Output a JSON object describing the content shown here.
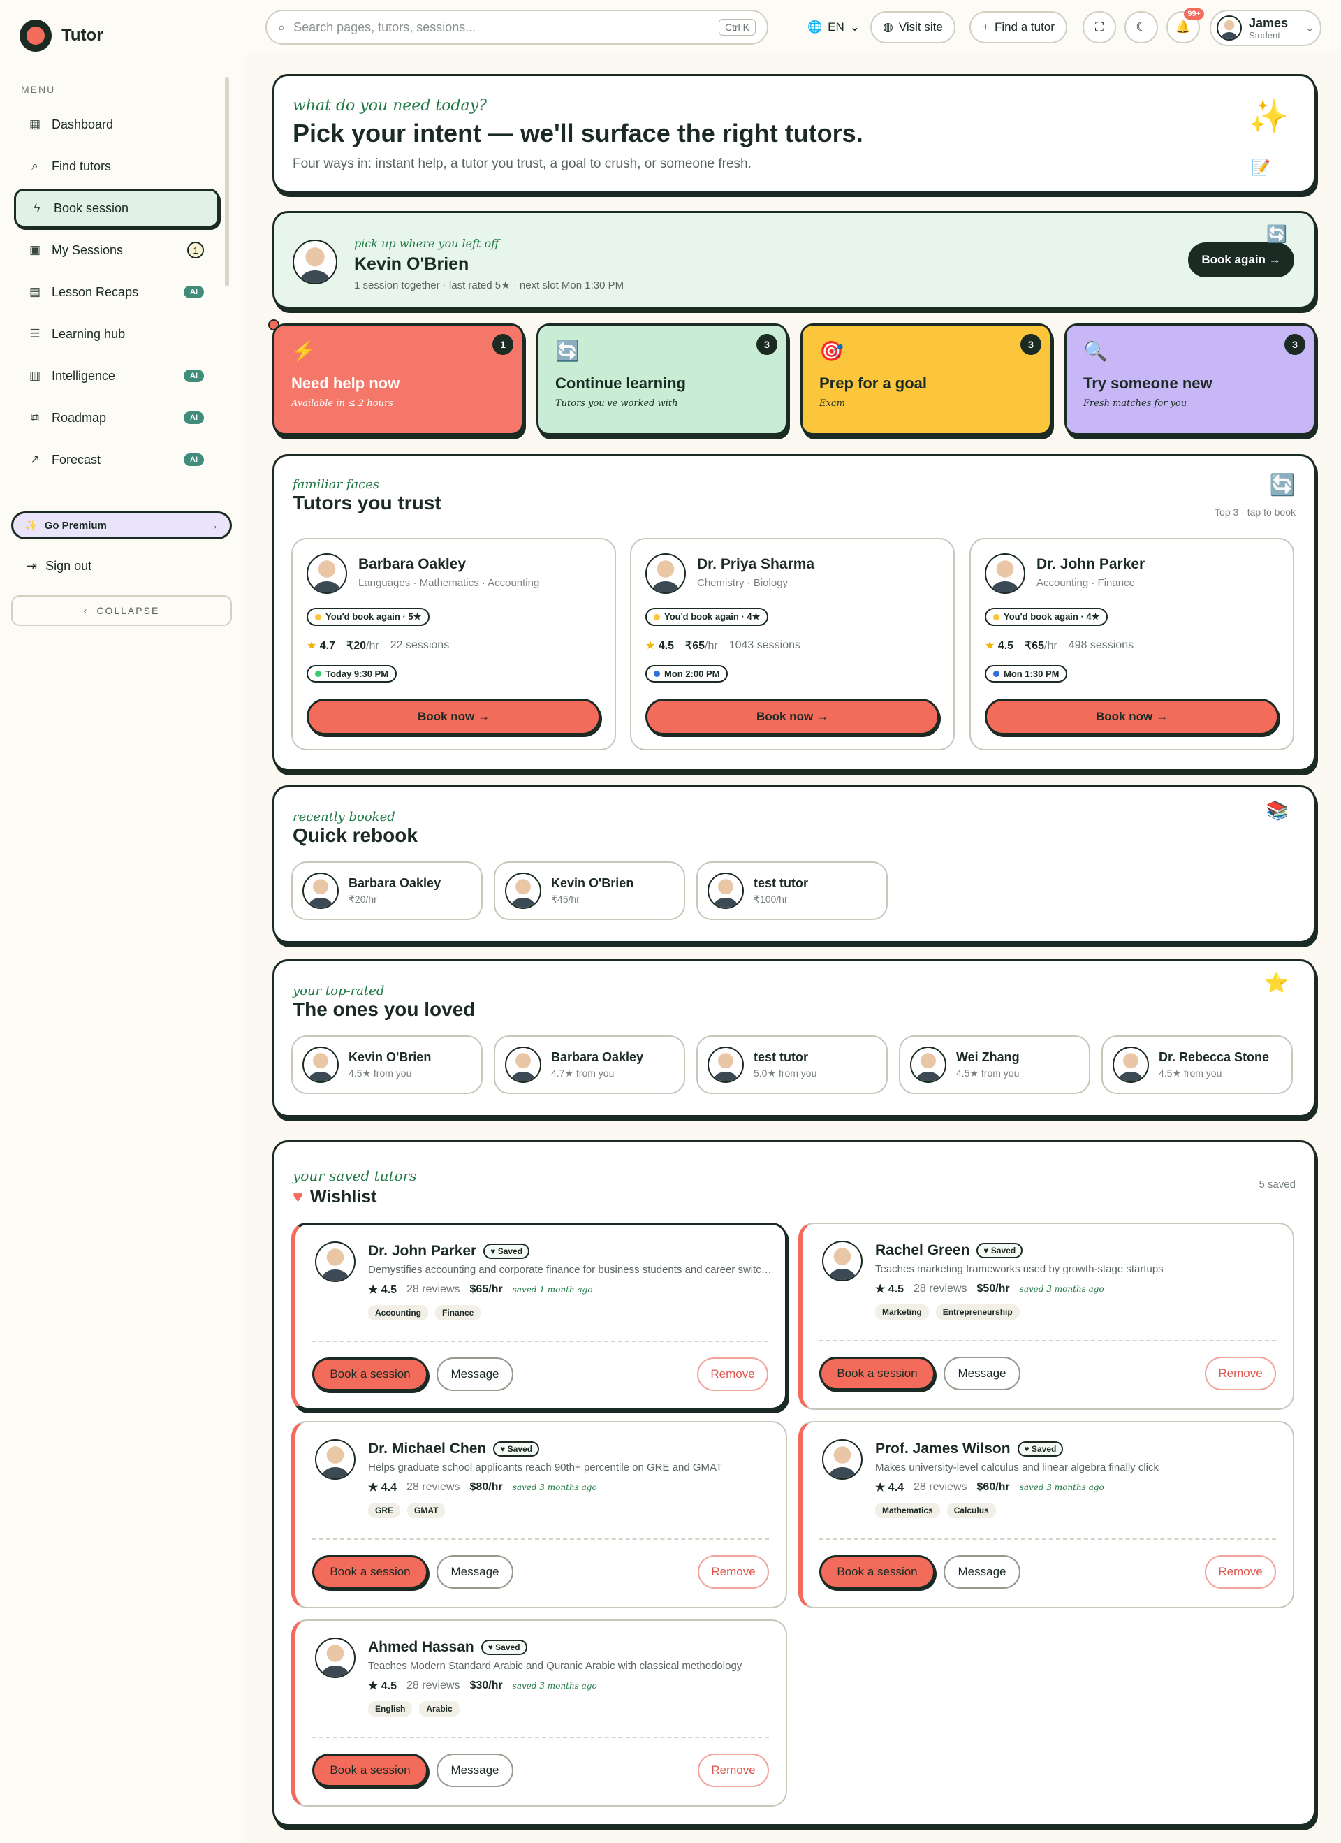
{
  "app": {
    "name": "Tutor"
  },
  "sidebar": {
    "menu_label": "MENU",
    "items": [
      {
        "label": "Dashboard",
        "icon": "grid-icon",
        "glyph": "▦"
      },
      {
        "label": "Find tutors",
        "icon": "search-icon",
        "glyph": "⌕"
      },
      {
        "label": "Book session",
        "icon": "lightning-icon",
        "glyph": "ϟ"
      },
      {
        "label": "My Sessions",
        "icon": "calendar-icon",
        "glyph": "▣",
        "badge": "1"
      },
      {
        "label": "Lesson Recaps",
        "icon": "document-icon",
        "glyph": "▤",
        "ai": "AI"
      },
      {
        "label": "Learning hub",
        "icon": "list-icon",
        "glyph": "☰"
      },
      {
        "label": "Intelligence",
        "icon": "bar-chart-icon",
        "glyph": "▥",
        "ai": "AI"
      },
      {
        "label": "Roadmap",
        "icon": "map-icon",
        "glyph": "⧉",
        "ai": "AI"
      },
      {
        "label": "Forecast",
        "icon": "trend-icon",
        "glyph": "↗",
        "ai": "AI"
      }
    ],
    "premium": "Go Premium",
    "signout": "Sign out",
    "collapse": "COLLAPSE"
  },
  "topbar": {
    "search_placeholder": "Search pages, tutors, sessions...",
    "shortcut": "Ctrl K",
    "language": "EN",
    "visit_site": "Visit site",
    "find_tutor": "Find a tutor",
    "notifications": "99+",
    "user_name": "James",
    "user_role": "Student"
  },
  "hero": {
    "kicker": "what do you need today?",
    "title": "Pick your intent — we'll surface the right tutors.",
    "subtitle": "Four ways in: instant help, a tutor you trust, a goal to crush, or someone fresh."
  },
  "resume": {
    "kicker": "pick up where you left off",
    "name": "Kevin O'Brien",
    "meta": "1 session together · last rated 5★ · next slot Mon 1:30 PM",
    "button": "Book again →"
  },
  "intents": [
    {
      "title": "Need help now",
      "sub": "Available in ≤ 2 hours",
      "count": "1",
      "bg": "#f5776a",
      "fg": "#ffffff",
      "glyph": "⚡"
    },
    {
      "title": "Continue learning",
      "sub": "Tutors you've worked with",
      "count": "3",
      "bg": "#c9ecd4",
      "fg": "#1b2b24",
      "glyph": "🔄"
    },
    {
      "title": "Prep for a goal",
      "sub": "Exam",
      "count": "3",
      "bg": "#fcc63c",
      "fg": "#1b2b24",
      "glyph": "🎯"
    },
    {
      "title": "Try someone new",
      "sub": "Fresh matches for you",
      "count": "3",
      "bg": "#c7b7f7",
      "fg": "#1b2b24",
      "glyph": "🔍"
    }
  ],
  "trust": {
    "kicker": "familiar faces",
    "title": "Tutors you trust",
    "hint": "Top 3 · tap to book",
    "tutors": [
      {
        "name": "Barbara Oakley",
        "subjects": "Languages · Mathematics · Accounting",
        "again": "You'd book again · 5★",
        "rating": "4.7",
        "price": "₹20",
        "unit": "/hr",
        "sessions": "22 sessions",
        "slot": "Today 9:30 PM",
        "slot_color": "#3ccb6c",
        "book": "Book now →"
      },
      {
        "name": "Dr. Priya Sharma",
        "subjects": "Chemistry · Biology",
        "again": "You'd book again · 4★",
        "rating": "4.5",
        "price": "₹65",
        "unit": "/hr",
        "sessions": "1043 sessions",
        "slot": "Mon 2:00 PM",
        "slot_color": "#2f6fe0",
        "book": "Book now →"
      },
      {
        "name": "Dr. John Parker",
        "subjects": "Accounting · Finance",
        "again": "You'd book again · 4★",
        "rating": "4.5",
        "price": "₹65",
        "unit": "/hr",
        "sessions": "498 sessions",
        "slot": "Mon 1:30 PM",
        "slot_color": "#2f6fe0",
        "book": "Book now →"
      }
    ]
  },
  "rebook": {
    "kicker": "recently booked",
    "title": "Quick rebook",
    "tutors": [
      {
        "name": "Barbara Oakley",
        "sub": "₹20/hr"
      },
      {
        "name": "Kevin O'Brien",
        "sub": "₹45/hr"
      },
      {
        "name": "test tutor",
        "sub": "₹100/hr"
      }
    ]
  },
  "loved": {
    "kicker": "your top-rated",
    "title": "The ones you loved",
    "tutors": [
      {
        "name": "Kevin O'Brien",
        "sub": "4.5★ from you"
      },
      {
        "name": "Barbara Oakley",
        "sub": "4.7★ from you"
      },
      {
        "name": "test tutor",
        "sub": "5.0★ from you"
      },
      {
        "name": "Wei Zhang",
        "sub": "4.5★ from you"
      },
      {
        "name": "Dr. Rebecca Stone",
        "sub": "4.5★ from you"
      }
    ]
  },
  "wishlist": {
    "kicker": "your saved tutors",
    "title": "Wishlist",
    "count": "5 saved",
    "saved_label": "♥ Saved",
    "book": "Book a session",
    "message": "Message",
    "remove": "Remove",
    "reviews_suffix": "28 reviews",
    "tutors": [
      {
        "name": "Dr. John Parker",
        "desc": "Demystifies accounting and corporate finance for business students and career switchers",
        "rating": "★ 4.5",
        "reviews": "28 reviews",
        "price": "$65/hr",
        "ago": "saved 1 month ago",
        "tags": [
          "Accounting",
          "Finance"
        ]
      },
      {
        "name": "Rachel Green",
        "desc": "Teaches marketing frameworks used by growth-stage startups",
        "rating": "★ 4.5",
        "reviews": "28 reviews",
        "price": "$50/hr",
        "ago": "saved 3 months ago",
        "tags": [
          "Marketing",
          "Entrepreneurship"
        ]
      },
      {
        "name": "Dr. Michael Chen",
        "desc": "Helps graduate school applicants reach 90th+ percentile on GRE and GMAT",
        "rating": "★ 4.4",
        "reviews": "28 reviews",
        "price": "$80/hr",
        "ago": "saved 3 months ago",
        "tags": [
          "GRE",
          "GMAT"
        ]
      },
      {
        "name": "Prof. James Wilson",
        "desc": "Makes university-level calculus and linear algebra finally click",
        "rating": "★ 4.4",
        "reviews": "28 reviews",
        "price": "$60/hr",
        "ago": "saved 3 months ago",
        "tags": [
          "Mathematics",
          "Calculus"
        ]
      },
      {
        "name": "Ahmed Hassan",
        "desc": "Teaches Modern Standard Arabic and Quranic Arabic with classical methodology",
        "rating": "★ 4.5",
        "reviews": "28 reviews",
        "price": "$30/hr",
        "ago": "saved 3 months ago",
        "tags": [
          "English",
          "Arabic"
        ]
      }
    ]
  },
  "colors": {
    "accent": "#f26b5b",
    "ink": "#1b2b24",
    "green": "#217a45"
  }
}
